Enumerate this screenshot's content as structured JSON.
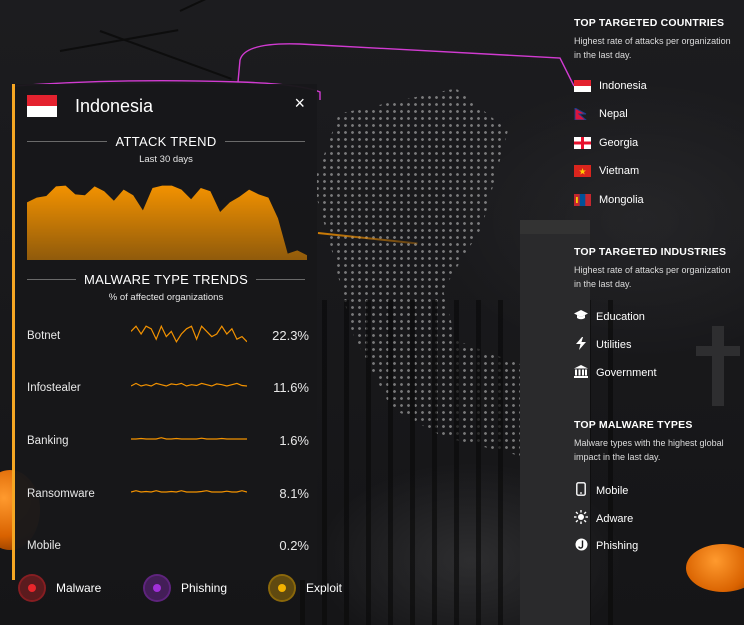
{
  "panel": {
    "country": "Indonesia",
    "close_label": "×",
    "attack_trend": {
      "title": "ATTACK TREND",
      "subtitle": "Last 30 days",
      "fill_color": "#f39200",
      "level": [
        0.72,
        0.78,
        0.8,
        0.92,
        0.93,
        0.82,
        0.81,
        0.92,
        0.86,
        0.74,
        0.88,
        0.81,
        0.62,
        0.9,
        0.93,
        0.93,
        0.88,
        0.76,
        0.9,
        0.86,
        0.6,
        0.72,
        0.79,
        0.88,
        0.82,
        0.78,
        0.52,
        0.08,
        0.12,
        0.06
      ]
    },
    "malware_trends": {
      "title": "MALWARE TYPE TRENDS",
      "subtitle": "% of affected organizations",
      "rows": [
        {
          "name": "Botnet",
          "value": "22.3%",
          "spark": [
            0.6,
            0.8,
            0.5,
            0.8,
            0.7,
            0.3,
            0.8,
            0.4,
            0.6,
            0.2,
            0.5,
            0.7,
            0.8,
            0.3,
            0.8,
            0.6,
            0.4,
            0.5,
            0.8,
            0.5,
            0.7,
            0.3,
            0.4,
            0.2
          ]
        },
        {
          "name": "Infostealer",
          "value": "11.6%",
          "spark": [
            0.5,
            0.6,
            0.5,
            0.55,
            0.5,
            0.6,
            0.55,
            0.5,
            0.58,
            0.55,
            0.6,
            0.5,
            0.55,
            0.52,
            0.6,
            0.55,
            0.5,
            0.58,
            0.55,
            0.5,
            0.55,
            0.6,
            0.52,
            0.5
          ]
        },
        {
          "name": "Banking",
          "value": "1.6%",
          "spark": [
            0.5,
            0.5,
            0.52,
            0.5,
            0.5,
            0.5,
            0.55,
            0.5,
            0.5,
            0.52,
            0.5,
            0.5,
            0.5,
            0.5,
            0.53,
            0.5,
            0.5,
            0.5,
            0.52,
            0.5,
            0.5,
            0.5,
            0.5,
            0.5
          ]
        },
        {
          "name": "Ransomware",
          "value": "8.1%",
          "spark": [
            0.5,
            0.55,
            0.5,
            0.52,
            0.5,
            0.55,
            0.5,
            0.5,
            0.52,
            0.5,
            0.55,
            0.5,
            0.5,
            0.5,
            0.52,
            0.55,
            0.5,
            0.5,
            0.5,
            0.53,
            0.5,
            0.5,
            0.55,
            0.5
          ]
        },
        {
          "name": "Mobile",
          "value": "0.2%",
          "spark": []
        }
      ]
    }
  },
  "countries": {
    "title": "TOP TARGETED COUNTRIES",
    "desc": "Highest rate of attacks per organization in the last day.",
    "items": [
      {
        "name": "Indonesia",
        "flag": "indonesia-flag-icon"
      },
      {
        "name": "Nepal",
        "flag": "nepal-flag-icon"
      },
      {
        "name": "Georgia",
        "flag": "georgia-flag-icon"
      },
      {
        "name": "Vietnam",
        "flag": "vietnam-flag-icon"
      },
      {
        "name": "Mongolia",
        "flag": "mongolia-flag-icon"
      }
    ]
  },
  "industries": {
    "title": "TOP TARGETED INDUSTRIES",
    "desc": "Highest rate of attacks per organization in the last day.",
    "items": [
      {
        "name": "Education",
        "icon": "graduation-cap-icon"
      },
      {
        "name": "Utilities",
        "icon": "lightning-bolt-icon"
      },
      {
        "name": "Government",
        "icon": "government-building-icon"
      }
    ]
  },
  "malware_types": {
    "title": "TOP MALWARE TYPES",
    "desc": "Malware types with the highest global impact in the last day.",
    "items": [
      {
        "name": "Mobile",
        "icon": "mobile-phone-icon"
      },
      {
        "name": "Adware",
        "icon": "adware-burst-icon"
      },
      {
        "name": "Phishing",
        "icon": "phishing-hook-icon"
      }
    ]
  },
  "legend": [
    {
      "label": "Malware",
      "color": "#e8262b"
    },
    {
      "label": "Phishing",
      "color": "#a030d8"
    },
    {
      "label": "Exploit",
      "color": "#f2b100"
    }
  ],
  "colors": {
    "accent": "#f39200",
    "panel_border": "#f5a623",
    "annotation": "#d13bd1"
  }
}
